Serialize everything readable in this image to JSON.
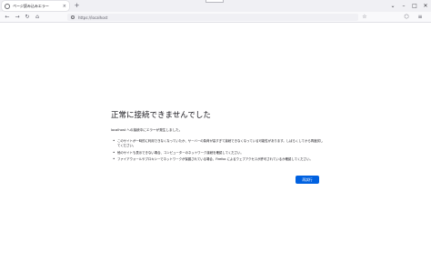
{
  "tab": {
    "title": "ページ読み込みエラー",
    "icon": "warning-circle-icon",
    "close_glyph": "×"
  },
  "newtab_glyph": "+",
  "window_controls": {
    "list_glyph": "⌄",
    "minimize_glyph": "–",
    "maximize_glyph": "□",
    "close_glyph": "✕"
  },
  "nav": {
    "back_glyph": "←",
    "forward_glyph": "→",
    "reload_glyph": "↻",
    "home_glyph": "⌂",
    "url": "https://localhost",
    "bookmark_glyph": "☆",
    "extension_glyph": "⬡",
    "menu_glyph": "≡"
  },
  "error": {
    "title": "正常に接続できませんでした",
    "description": "localhost への接続中にエラーが発生しました。",
    "tips": [
      "このサイトが一時的に利用できなくなっていたか、サーバーの負荷が高すぎて接続できなくなっている可能性があります。しばらくしてから再度試してください。",
      "他のサイトも表示できない場合、コンピューターのネットワーク接続を確認してください。",
      "ファイアウォールやプロキシーでネットワークが保護されている場合、Firefox によるウェブアクセスが許可されているか確認してください。"
    ],
    "retry_label": "再試行"
  },
  "colors": {
    "accent": "#0061e0",
    "tabstrip": "#f0f0f4",
    "toolbar": "#f9f9fb"
  }
}
